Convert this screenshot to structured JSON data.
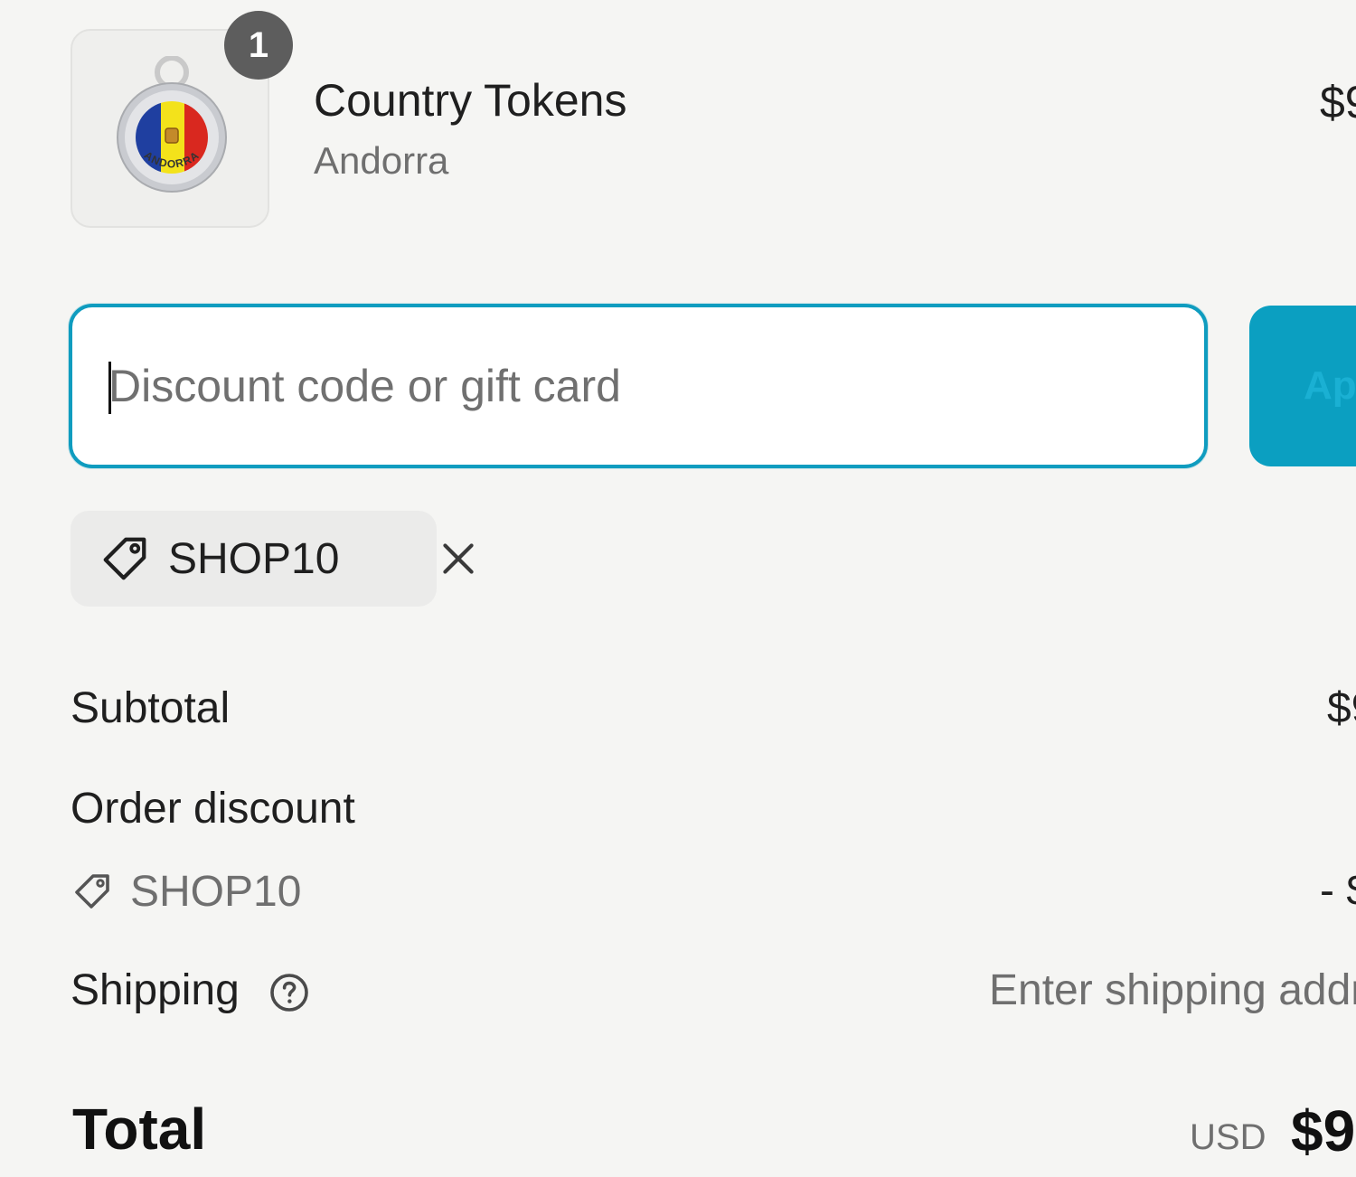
{
  "line_item": {
    "quantity": "1",
    "name": "Country Tokens",
    "variant": "Andorra",
    "price": "$9",
    "image_text": "ANDORRA"
  },
  "discount": {
    "placeholder": "Discount code or gift card",
    "value": "",
    "apply_label": "Apply",
    "applied_code": "SHOP10"
  },
  "summary": {
    "subtotal_label": "Subtotal",
    "subtotal_value": "$9",
    "order_discount_label": "Order discount",
    "discount_code": "SHOP10",
    "discount_value": "- $",
    "shipping_label": "Shipping",
    "shipping_value": "Enter shipping address",
    "total_label": "Total",
    "currency": "USD",
    "total_value": "$9"
  },
  "colors": {
    "accent": "#0f9cbf",
    "background": "#f5f5f3",
    "badge": "#5d5d5d"
  },
  "icons": {
    "tag": "tag-icon",
    "remove": "close-icon",
    "help": "question-circle-icon"
  }
}
